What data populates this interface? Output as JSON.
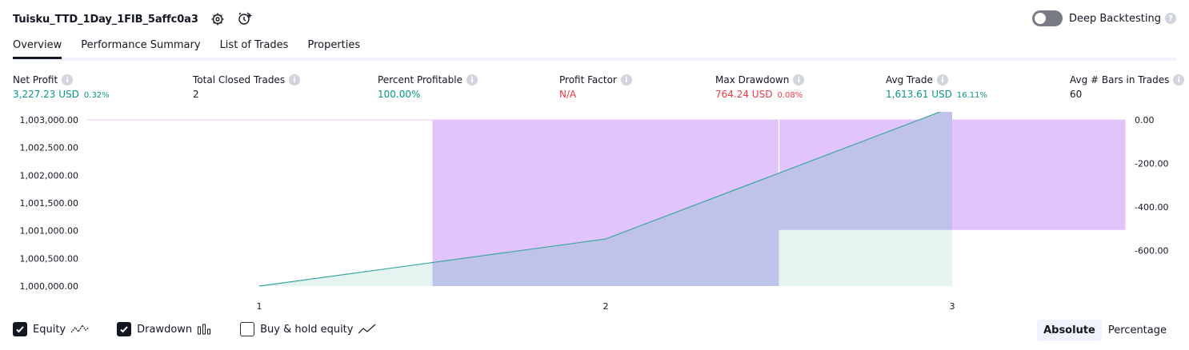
{
  "header": {
    "title": "Tuisku_TTD_1Day_1FIB_5affc0a3",
    "settings_icon": "gear-icon",
    "alert_icon": "add-alert-icon"
  },
  "deep_backtesting": {
    "label": "Deep Backtesting",
    "enabled": false,
    "help": "?"
  },
  "tabs": [
    {
      "label": "Overview",
      "active": true
    },
    {
      "label": "Performance Summary",
      "active": false
    },
    {
      "label": "List of Trades",
      "active": false
    },
    {
      "label": "Properties",
      "active": false
    }
  ],
  "metrics": {
    "net_profit": {
      "label": "Net Profit",
      "value": "3,227.23 USD",
      "pct": "0.32%"
    },
    "total_closed_trades": {
      "label": "Total Closed Trades",
      "value": "2"
    },
    "percent_profitable": {
      "label": "Percent Profitable",
      "value": "100.00%"
    },
    "profit_factor": {
      "label": "Profit Factor",
      "value": "N/A"
    },
    "max_drawdown": {
      "label": "Max Drawdown",
      "value": "764.24 USD",
      "pct": "0.08%"
    },
    "avg_trade": {
      "label": "Avg Trade",
      "value": "1,613.61 USD",
      "pct": "16.11%"
    },
    "avg_bars": {
      "label": "Avg # Bars in Trades",
      "value": "60"
    }
  },
  "colors": {
    "green": "#089981",
    "red": "#f23645",
    "equity_line": "#3aa6a0",
    "equity_fill": "#e0f3ef",
    "drawdown": "#e1c4fb",
    "overlap": "#b6b8e9"
  },
  "chart_data": {
    "type": "area",
    "x_ticks": [
      "1",
      "2",
      "3"
    ],
    "left_axis_ticks": [
      "1,003,000.00",
      "1,002,500.00",
      "1,002,000.00",
      "1,001,500.00",
      "1,001,000.00",
      "1,000,500.00",
      "1,000,000.00"
    ],
    "right_axis_ticks": [
      "0.00",
      "-200.00",
      "-400.00",
      "-600.00"
    ],
    "ylim_left": [
      1000000,
      1003000
    ],
    "ylim_right": [
      -764.24,
      0
    ],
    "equity": {
      "x": [
        1,
        2,
        3
      ],
      "y": [
        1000000,
        1000850,
        1003227.23
      ]
    },
    "drawdown": {
      "x": [
        1,
        2,
        3
      ],
      "y": [
        0,
        -764.24,
        -530
      ]
    },
    "grid": false
  },
  "footer": {
    "equity": {
      "label": "Equity",
      "checked": true
    },
    "drawdown": {
      "label": "Drawdown",
      "checked": true
    },
    "buy_hold": {
      "label": "Buy & hold equity",
      "checked": false
    }
  },
  "toggle_mode": {
    "absolute": "Absolute",
    "percentage": "Percentage",
    "selected": "absolute"
  }
}
